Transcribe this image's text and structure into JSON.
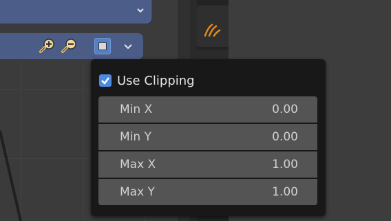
{
  "popup": {
    "use_clipping_label": "Use Clipping",
    "use_clipping_checked": true,
    "fields": [
      {
        "name": "Min X",
        "value": "0.00"
      },
      {
        "name": "Min Y",
        "value": "0.00"
      },
      {
        "name": "Max X",
        "value": "1.00"
      },
      {
        "name": "Max Y",
        "value": "1.00"
      }
    ]
  },
  "toolbar": {
    "icons": [
      "zoom-in-icon",
      "zoom-out-icon",
      "clipping-icon",
      "chevron-down-icon"
    ]
  },
  "colors": {
    "accent": "#4c8ce0",
    "header_blue": "#4b5c86",
    "orange_tab": "#e08a1e"
  }
}
